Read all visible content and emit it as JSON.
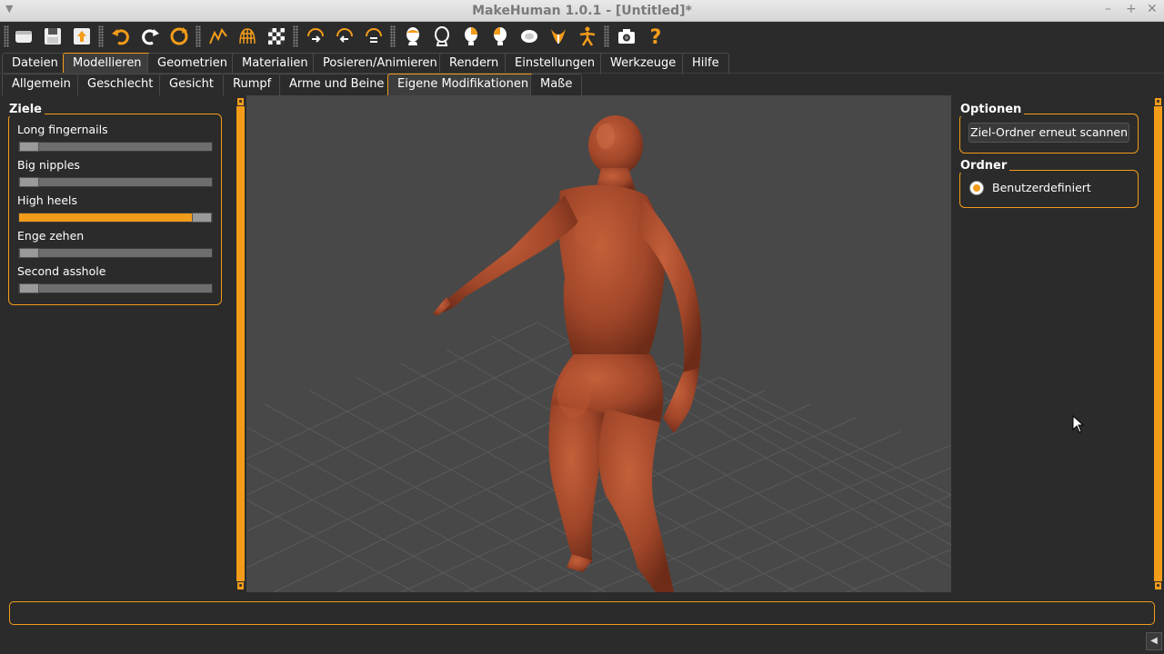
{
  "window": {
    "title": "MakeHuman 1.0.1 - [Untitled]*"
  },
  "toolbar": {
    "icons": [
      "file-new-icon",
      "save-icon",
      "export-icon",
      "undo-icon",
      "redo-icon",
      "reset-icon",
      "smooth-icon",
      "wireframe-icon",
      "background-icon",
      "front-view-icon",
      "back-view-icon",
      "top-view-icon",
      "head-front-icon",
      "head-back-icon",
      "head-left-icon",
      "head-right-icon",
      "head-top-icon",
      "pose-icon",
      "skeleton-icon",
      "screenshot-icon",
      "help-icon"
    ]
  },
  "main_tabs": [
    "Dateien",
    "Modellieren",
    "Geometrien",
    "Materialien",
    "Posieren/Animieren",
    "Rendern",
    "Einstellungen",
    "Werkzeuge",
    "Hilfe"
  ],
  "main_tabs_active": "Modellieren",
  "sub_tabs": [
    "Allgemein",
    "Geschlecht",
    "Gesicht",
    "Rumpf",
    "Arme und Beine",
    "Eigene Modifikationen",
    "Maße"
  ],
  "sub_tabs_active": "Eigene Modifikationen",
  "left_panel": {
    "group_title": "Ziele",
    "sliders": [
      {
        "label": "Long fingernails",
        "value": 0.0
      },
      {
        "label": "Big nipples",
        "value": 0.0
      },
      {
        "label": "High heels",
        "value": 1.0
      },
      {
        "label": "Enge zehen",
        "value": 0.0
      },
      {
        "label": "Second asshole",
        "value": 0.0
      }
    ]
  },
  "right_panel": {
    "options_title": "Optionen",
    "rescan_button": "Ziel-Ordner erneut scannen",
    "folder_title": "Ordner",
    "folder_radio": "Benutzerdefiniert"
  },
  "colors": {
    "accent": "#f39c1a",
    "background": "#2b2b2b",
    "viewport": "#484848",
    "skin": "#a94a2c"
  }
}
